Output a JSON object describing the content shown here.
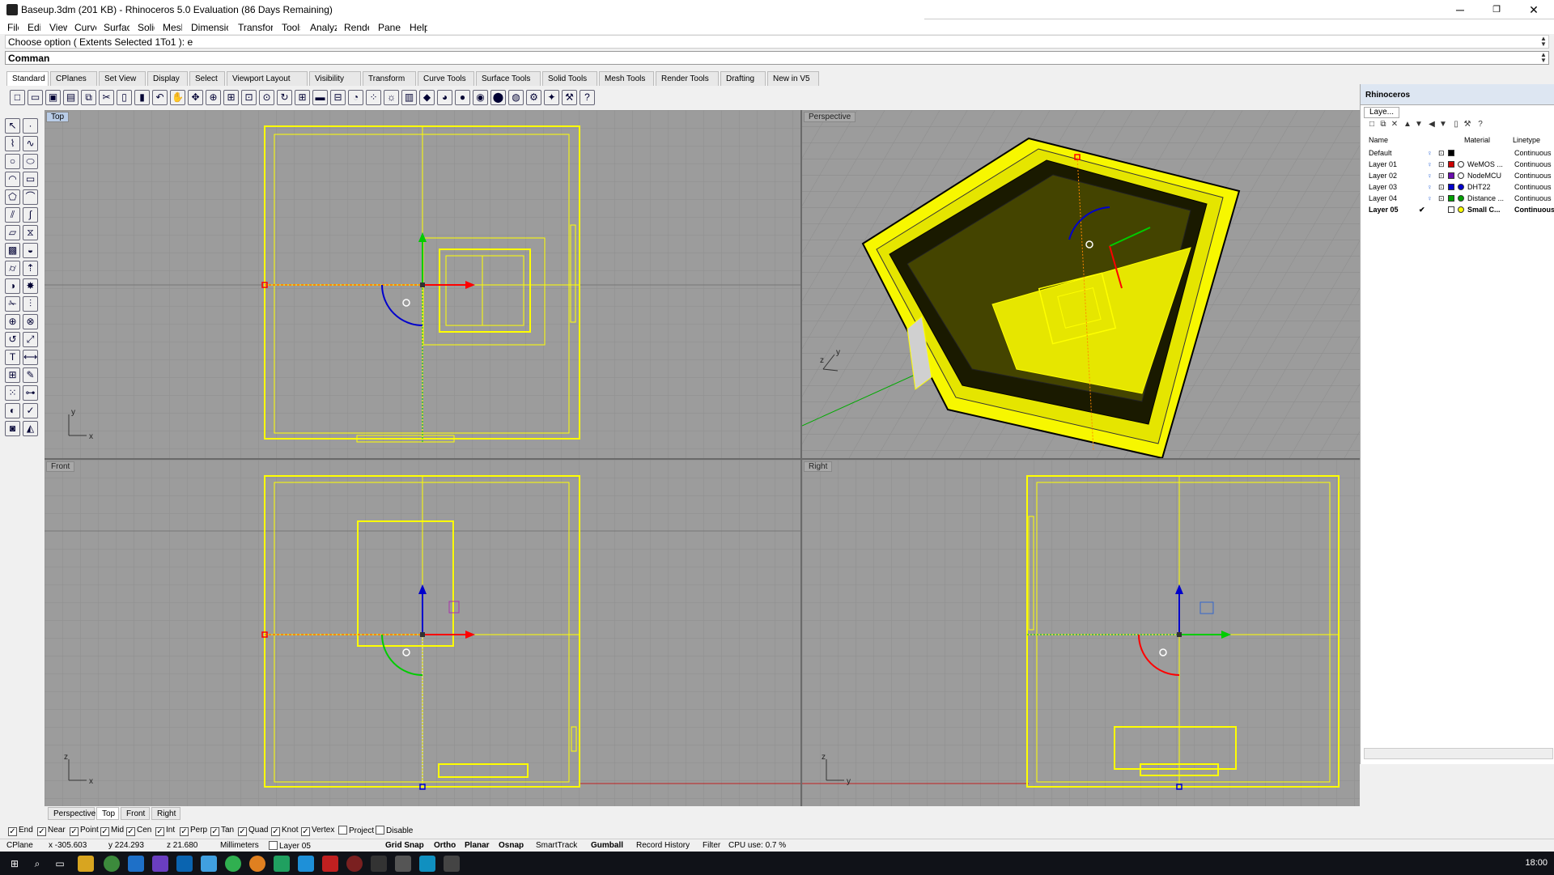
{
  "titlebar": {
    "title": "Baseup.3dm (201 KB) - Rhinoceros 5.0 Evaluation (86 Days Remaining)",
    "minimize": "─",
    "restore": "❐",
    "close": "✕"
  },
  "menu": [
    "File",
    "Edit",
    "View",
    "Curve",
    "Surface",
    "Solid",
    "Mesh",
    "Dimension",
    "Transform",
    "Tools",
    "Analyze",
    "Render",
    "Panels",
    "Help"
  ],
  "history_text": "Choose option ( Extents  Selected  1To1 ): e",
  "command_label": "Comman",
  "tabs": [
    "Standard",
    "CPlanes",
    "Set View",
    "Display",
    "Select",
    "Viewport Layout",
    "Visibility",
    "Transform",
    "Curve Tools",
    "Surface Tools",
    "Solid Tools",
    "Mesh Tools",
    "Render Tools",
    "Drafting",
    "New in V5"
  ],
  "viewports": {
    "top": "Top",
    "perspective": "Perspective",
    "front": "Front",
    "right": "Right"
  },
  "axis_labels": {
    "x": "x",
    "y": "y",
    "z": "z"
  },
  "viewport_tabs": [
    "Perspective",
    "Top",
    "Front",
    "Right"
  ],
  "osnaps": [
    {
      "label": "End",
      "checked": true
    },
    {
      "label": "Near",
      "checked": true
    },
    {
      "label": "Point",
      "checked": true
    },
    {
      "label": "Mid",
      "checked": true
    },
    {
      "label": "Cen",
      "checked": true
    },
    {
      "label": "Int",
      "checked": true
    },
    {
      "label": "Perp",
      "checked": true
    },
    {
      "label": "Tan",
      "checked": true
    },
    {
      "label": "Quad",
      "checked": true
    },
    {
      "label": "Knot",
      "checked": true
    },
    {
      "label": "Vertex",
      "checked": true
    },
    {
      "label": "Project",
      "checked": false
    },
    {
      "label": "Disable",
      "checked": false
    }
  ],
  "status": {
    "cplane": "CPlane",
    "x": "x -305.603",
    "y": "y 224.293",
    "z": "z 21.680",
    "units": "Millimeters",
    "layer": "Layer 05",
    "grid_snap": "Grid Snap",
    "ortho": "Ortho",
    "planar": "Planar",
    "osnap": "Osnap",
    "smarttrack": "SmartTrack",
    "gumball": "Gumball",
    "record_history": "Record History",
    "filter": "Filter",
    "cpu": "CPU use: 0.7 %"
  },
  "panel": {
    "title": "Rhinoceros",
    "tab": "Laye...",
    "headers": {
      "name": "Name",
      "material": "Material",
      "linetype": "Linetype"
    },
    "layers": [
      {
        "name": "Default",
        "color": "#000000",
        "material": "",
        "material_color": "",
        "linetype": "Continuous",
        "current": false
      },
      {
        "name": "Layer 01",
        "color": "#cc0000",
        "material": "WeMOS ...",
        "material_color": "#ffffff",
        "linetype": "Continuous",
        "current": false
      },
      {
        "name": "Layer 02",
        "color": "#6a0dad",
        "material": "NodeMCU",
        "material_color": "#ffffff",
        "linetype": "Continuous",
        "current": false
      },
      {
        "name": "Layer 03",
        "color": "#0000cc",
        "material": "DHT22",
        "material_color": "#0000cc",
        "linetype": "Continuous",
        "current": false
      },
      {
        "name": "Layer 04",
        "color": "#00a000",
        "material": "Distance ...",
        "material_color": "#00a000",
        "linetype": "Continuous",
        "current": false
      },
      {
        "name": "Layer 05",
        "color": "#ffffff",
        "material": "Small C...",
        "material_color": "#ffff00",
        "linetype": "Continuous",
        "current": true,
        "check": "✔"
      }
    ]
  },
  "clock": "18:00",
  "colors": {
    "viewport_bg": "#9c9c9c",
    "grid": "#8a8a8a",
    "geometry": "#ffff00",
    "x_axis": "#ff0000",
    "y_axis": "#00cc00",
    "z_axis": "#0000ff"
  }
}
